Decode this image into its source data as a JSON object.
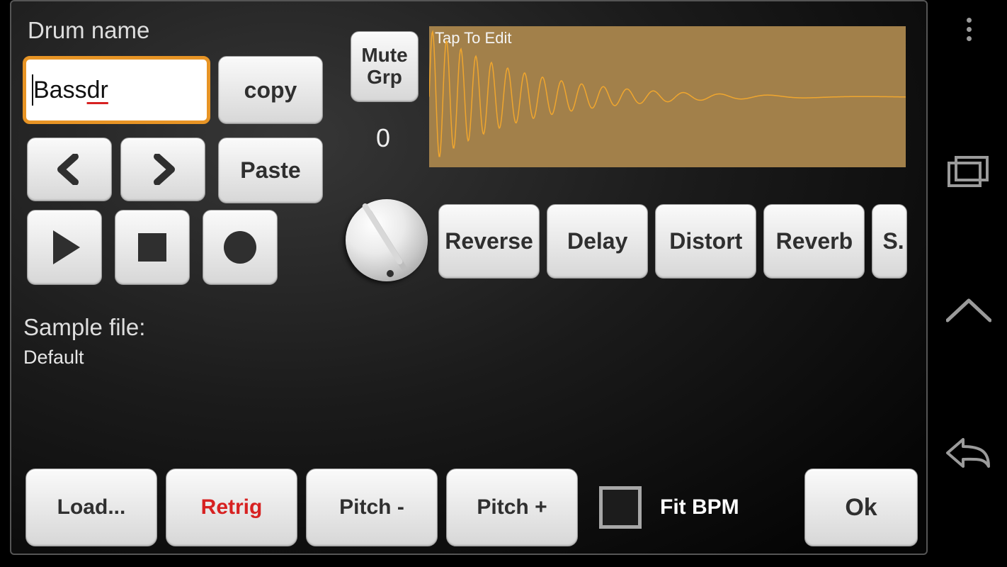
{
  "drumNameLabel": "Drum name",
  "drumName": {
    "plain": "Bass ",
    "underlined": "dr"
  },
  "copy": "copy",
  "paste": "Paste",
  "muteGrp": {
    "line1": "Mute",
    "line2": "Grp",
    "value": "0"
  },
  "waveformHint": "Tap To Edit",
  "effects": [
    "Reverse",
    "Delay",
    "Distort",
    "Reverb",
    "S."
  ],
  "sampleFileLabel": "Sample file:",
  "sampleFileValue": "Default",
  "bottom": {
    "load": "Load...",
    "retrig": "Retrig",
    "pitchMinus": "Pitch -",
    "pitchPlus": "Pitch +",
    "fitBpm": "Fit BPM",
    "ok": "Ok"
  }
}
